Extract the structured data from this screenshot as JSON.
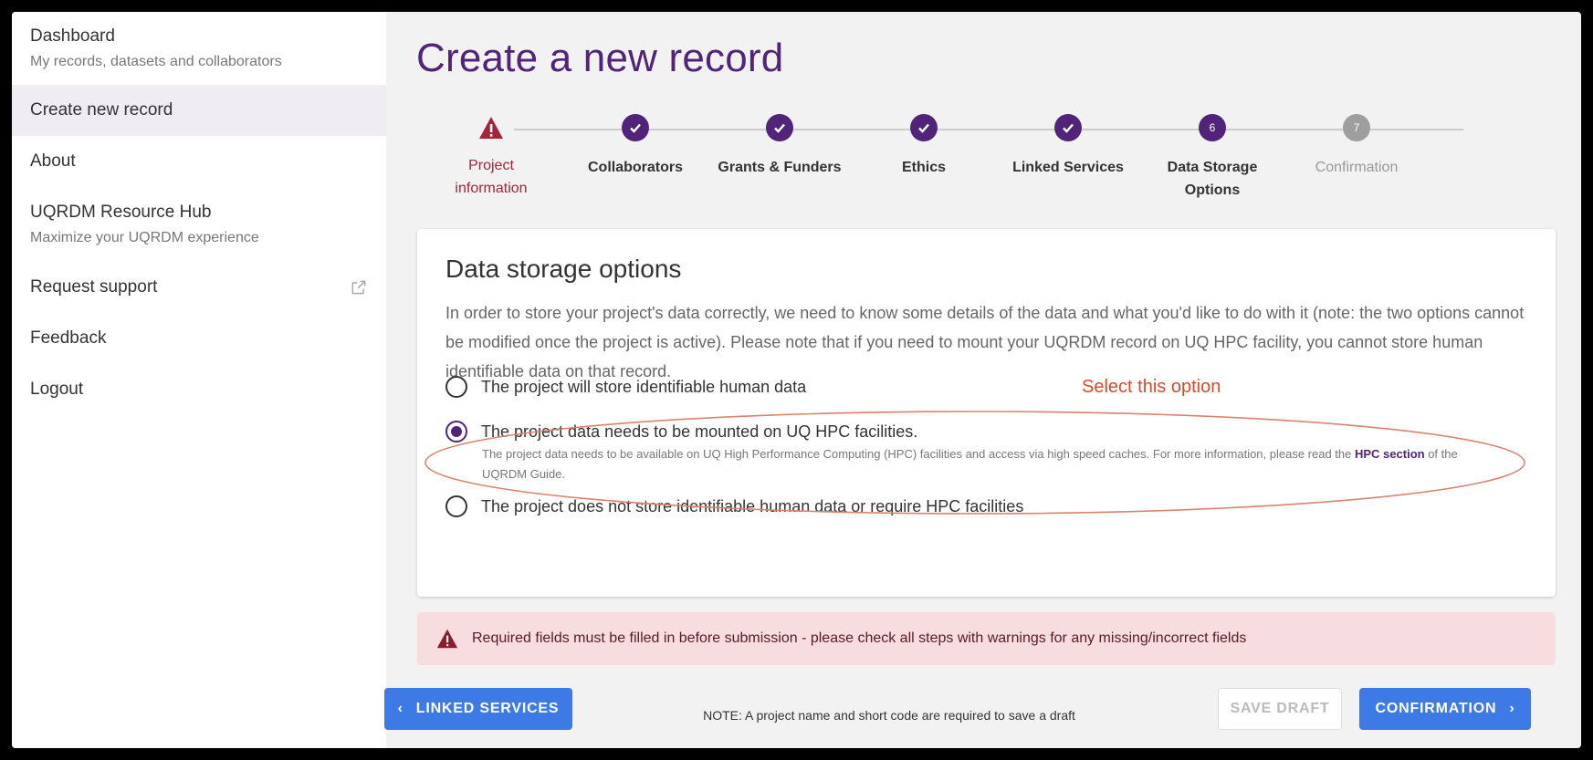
{
  "sidebar": {
    "items": [
      {
        "label": "Dashboard",
        "sub": "My records, datasets and collaborators"
      },
      {
        "label": "Create new record",
        "sub": ""
      },
      {
        "label": "About",
        "sub": ""
      },
      {
        "label": "UQRDM Resource Hub",
        "sub": "Maximize your UQRDM experience"
      },
      {
        "label": "Request support",
        "sub": ""
      },
      {
        "label": "Feedback",
        "sub": ""
      },
      {
        "label": "Logout",
        "sub": ""
      }
    ]
  },
  "main": {
    "title": "Create a new record",
    "steps": [
      {
        "label": "Project information",
        "status": "warning",
        "icon": "warning-icon"
      },
      {
        "label": "Collaborators",
        "status": "done",
        "icon": "check-icon"
      },
      {
        "label": "Grants & Funders",
        "status": "done",
        "icon": "check-icon"
      },
      {
        "label": "Ethics",
        "status": "done",
        "icon": "check-icon"
      },
      {
        "label": "Linked Services",
        "status": "done",
        "icon": "check-icon"
      },
      {
        "label": "Data Storage Options",
        "status": "current",
        "number": "6"
      },
      {
        "label": "Confirmation",
        "status": "todo",
        "number": "7"
      }
    ],
    "card": {
      "title": "Data storage options",
      "description": "In order to store your project's data correctly, we need to know some details of the data and what you'd like to do with it (note: the two options cannot be modified once the project is active). Please note that if you need to mount your UQRDM record on UQ HPC facility, you cannot store human identifiable data on that record.",
      "options": [
        {
          "label": "The project will store identifiable human data",
          "checked": false
        },
        {
          "label": "The project data needs to be mounted on UQ HPC facilities.",
          "checked": true,
          "help_before": "The project data needs to be available on UQ High Performance Computing (HPC) facilities and access via high speed caches. For more information, please read the ",
          "help_link": "HPC section",
          "help_after": " of the UQRDM Guide."
        },
        {
          "label": "The project does not store identifiable human data or require HPC facilities",
          "checked": false
        }
      ],
      "annotation": "Select this option"
    },
    "alert": "Required fields must be filled in before submission - please check all steps with warnings for any missing/incorrect fields",
    "footer": {
      "back_label": "Linked Services",
      "note": "NOTE: A project name and short code are required to save a draft",
      "save_label": "Save Draft",
      "next_label": "Confirmation"
    }
  },
  "colors": {
    "brand": "#51247a",
    "primary_button": "#3e7ae6",
    "warning": "#a5243a",
    "alert_bg": "#f8dde0",
    "annotation": "#d34a2f"
  }
}
